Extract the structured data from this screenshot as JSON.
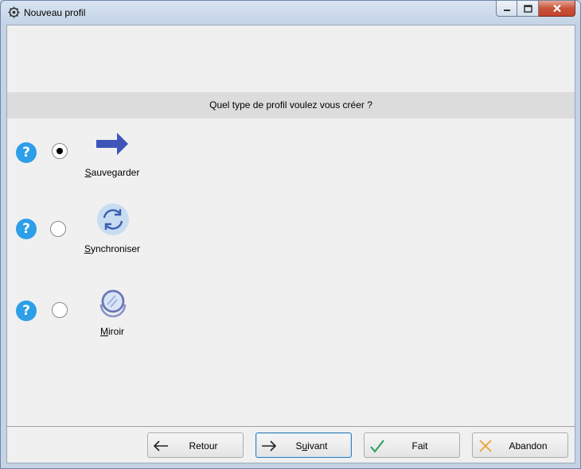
{
  "window": {
    "title": "Nouveau profil"
  },
  "question": "Quel type de profil voulez vous créer ?",
  "options": [
    {
      "label_first": "S",
      "label_rest": "auvegarder",
      "selected": true,
      "icon": "arrow-right-icon"
    },
    {
      "label_first": "S",
      "label_rest": "ynchroniser",
      "selected": false,
      "icon": "sync-icon"
    },
    {
      "label_first": "M",
      "label_rest": "iroir",
      "selected": false,
      "icon": "mirror-icon"
    }
  ],
  "help_glyph": "?",
  "buttons": {
    "back": {
      "label": "Retour",
      "icon": "arrow-left-icon"
    },
    "next": {
      "label_pre": "S",
      "label_ul": "u",
      "label_post": "ivant",
      "icon": "arrow-right-thin-icon"
    },
    "done": {
      "label": "Fait",
      "icon": "check-icon"
    },
    "cancel": {
      "label": "Abandon",
      "icon": "cross-icon"
    }
  },
  "colors": {
    "help": "#2d9ee8",
    "accent_arrow": "#3d56b8",
    "check": "#27a05a",
    "cross": "#f0a030"
  }
}
